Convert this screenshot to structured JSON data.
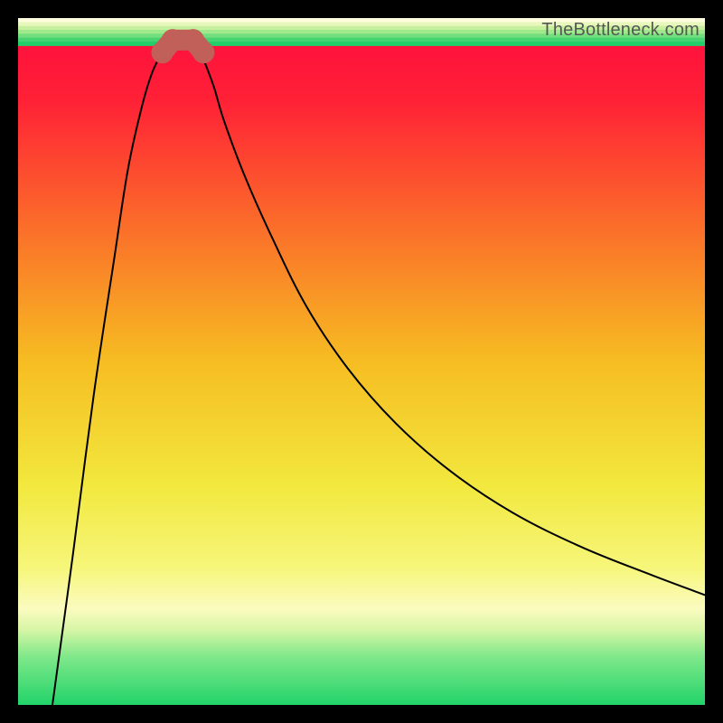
{
  "watermark": "TheBottleneck.com",
  "chart_data": {
    "type": "line",
    "title": "",
    "xlabel": "",
    "ylabel": "",
    "xlim": [
      0,
      100
    ],
    "ylim": [
      0,
      100
    ],
    "grid": false,
    "legend": false,
    "annotations": [],
    "gradient_stops": [
      {
        "offset": 0.0,
        "color": "#ff0b3f"
      },
      {
        "offset": 0.12,
        "color": "#ff2136"
      },
      {
        "offset": 0.3,
        "color": "#fb6c2a"
      },
      {
        "offset": 0.5,
        "color": "#f6bd22"
      },
      {
        "offset": 0.68,
        "color": "#f2e83e"
      },
      {
        "offset": 0.8,
        "color": "#f6f67a"
      },
      {
        "offset": 0.86,
        "color": "#fbfbc0"
      },
      {
        "offset": 0.89,
        "color": "#d8f6a6"
      },
      {
        "offset": 0.93,
        "color": "#7fe88a"
      },
      {
        "offset": 1.0,
        "color": "#22d36a"
      }
    ],
    "green_band": {
      "y0": 96,
      "y1": 100
    },
    "series": [
      {
        "name": "left-branch",
        "x": [
          5,
          8,
          11,
          14,
          16,
          18,
          19.5,
          21,
          22
        ],
        "y": [
          0,
          22,
          45,
          65,
          78,
          87,
          92,
          95,
          96.5
        ]
      },
      {
        "name": "right-branch",
        "x": [
          26,
          27,
          28.5,
          30,
          33,
          37,
          42,
          48,
          55,
          63,
          72,
          82,
          92,
          100
        ],
        "y": [
          96.5,
          94,
          90,
          85,
          77,
          68,
          58,
          49,
          41,
          34,
          28,
          23,
          19,
          16
        ]
      }
    ],
    "markers": [
      {
        "x": 21.0,
        "y": 95.0
      },
      {
        "x": 22.5,
        "y": 96.8
      },
      {
        "x": 25.5,
        "y": 96.8
      },
      {
        "x": 27.0,
        "y": 95.0
      }
    ],
    "marker_style": {
      "color": "#c06058",
      "radius_pct": 1.6
    }
  }
}
